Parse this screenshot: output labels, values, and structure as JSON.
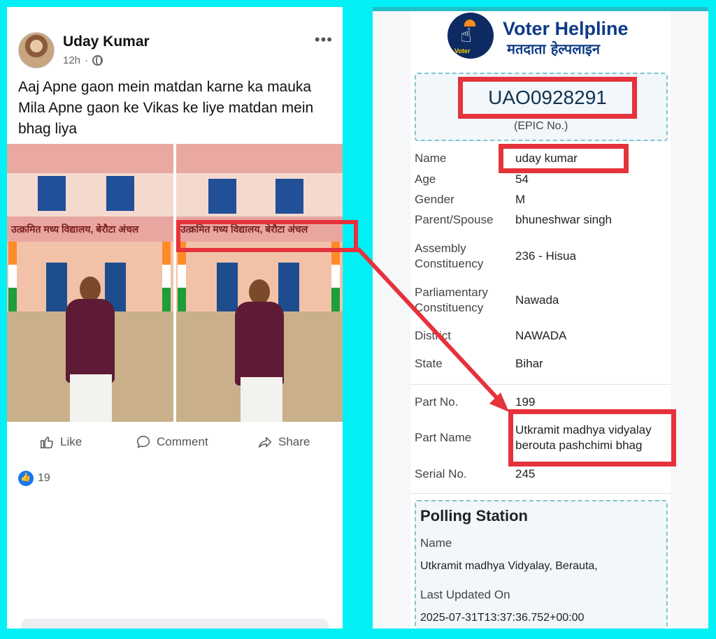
{
  "post": {
    "author": "Uday Kumar",
    "time": "12h",
    "time_sep": "·",
    "more": "•••",
    "text": "Aaj Apne gaon mein matdan karne ka mauka Mila  Apne gaon ke Vikas ke liye matdan mein bhag liya",
    "banner_text": "उत्क्रमित मध्य विद्यालय, बेरौटा अंचल",
    "actions": {
      "like": "Like",
      "comment": "Comment",
      "share": "Share"
    },
    "reactions_count": "19"
  },
  "voter": {
    "app_title": "Voter Helpline",
    "app_subtitle": "मतदाता हेल्पलाइन",
    "logo_text": "Voter",
    "epic_no": "UAO0928291",
    "epic_label": "(EPIC No.)",
    "fields": [
      {
        "label": "Name",
        "value": "uday kumar"
      },
      {
        "label": "Age",
        "value": "54"
      },
      {
        "label": "Gender",
        "value": "M"
      },
      {
        "label": "Parent/Spouse",
        "value": "bhuneshwar singh"
      },
      {
        "label": "Assembly Constituency",
        "value": "236 - Hisua"
      },
      {
        "label": "Parliamentary Constituency",
        "value": "Nawada"
      },
      {
        "label": "District",
        "value": "NAWADA"
      },
      {
        "label": "State",
        "value": "Bihar"
      }
    ],
    "part": [
      {
        "label": "Part No.",
        "value": "199"
      },
      {
        "label": "Part Name",
        "value": "Utkramit madhya vidyalay berouta pashchimi bhag"
      },
      {
        "label": "Serial No.",
        "value": "245"
      }
    ],
    "polling_station": {
      "title": "Polling Station",
      "name_label": "Name",
      "name_value": "Utkramit madhya Vidyalay, Berauta,",
      "updated_label": "Last Updated On",
      "updated_value": "2025-07-31T13:37:36.752+00:00"
    }
  },
  "colors": {
    "background": "#00f0f5",
    "highlight": "#e5323b",
    "brand": "#0d3a85",
    "like": "#1877f2"
  }
}
